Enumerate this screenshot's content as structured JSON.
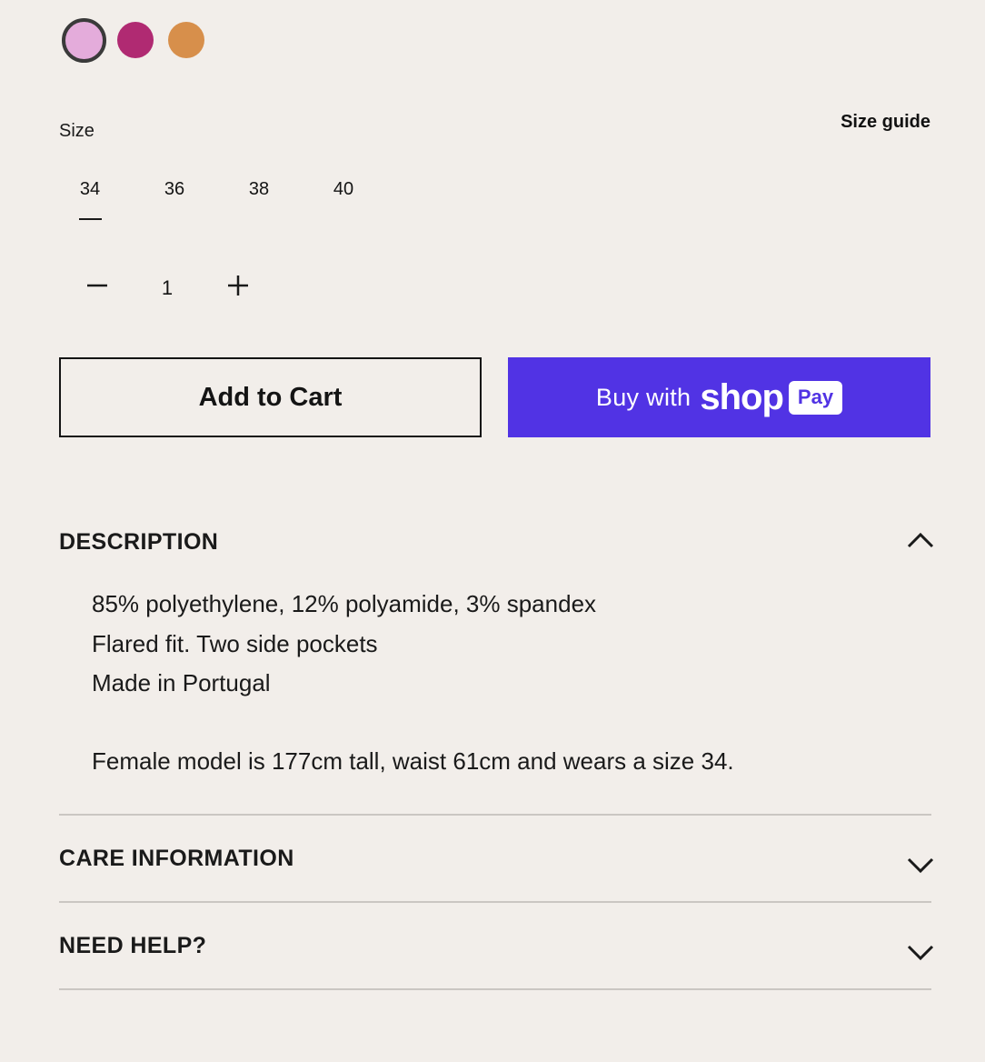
{
  "colors": {
    "swatches": [
      "#e4acdb",
      "#b02a72",
      "#d78f4b"
    ],
    "selected_swatch_index": 0,
    "shop_pay_bg": "#5133e4",
    "background": "#f2eeea"
  },
  "size": {
    "label": "Size",
    "guide_label": "Size guide",
    "options": [
      "34",
      "36",
      "38",
      "40"
    ],
    "selected": "34"
  },
  "quantity": {
    "value": "1",
    "decrement_icon": "minus-icon",
    "increment_icon": "plus-icon"
  },
  "actions": {
    "add_to_cart": "Add to Cart",
    "shop_pay_prefix": "Buy with",
    "shop_pay_brand": "shop",
    "shop_pay_pill": "Pay"
  },
  "accordions": {
    "description": {
      "title": "DESCRIPTION",
      "expanded": true,
      "lines": [
        "85% polyethylene, 12% polyamide, 3% spandex",
        "Flared fit. Two side pockets",
        "Made in Portugal",
        "Female model is 177cm tall, waist 61cm and wears a size 34."
      ]
    },
    "care": {
      "title": "CARE INFORMATION",
      "expanded": false
    },
    "help": {
      "title": "NEED HELP?",
      "expanded": false
    }
  }
}
